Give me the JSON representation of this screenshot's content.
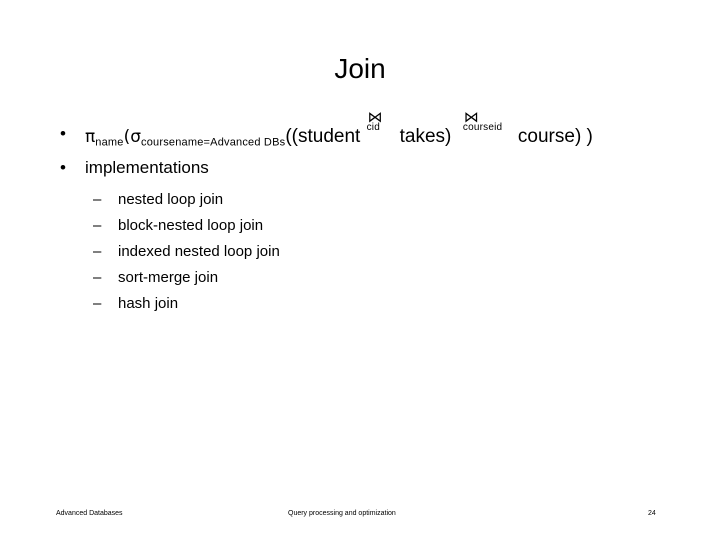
{
  "slide": {
    "title": "Join",
    "page_number": "24",
    "background_color": "#ffffff",
    "text_color": "#000000"
  },
  "body": {
    "bullets": [
      {
        "marker": "•",
        "kind": "formula",
        "formula": {
          "pi_symbol": "π",
          "pi_subscript": "name",
          "open_paren_1": "(",
          "sigma_symbol": "σ",
          "sigma_subscript": "coursename=Advanced DBs",
          "open_parens": "((",
          "relation_1": "student",
          "join_1_symbol": "⋈",
          "join_1_subscript": "cid",
          "relation_2": "takes",
          "close_paren_1": ")",
          "join_2_symbol": "⋈",
          "join_2_subscript": "courseid",
          "relation_3": "course",
          "close_parens": ") )",
          "plain_text": "πname(σcoursename=Advanced DBs((student ⋈cid takes) ⋈courseid course) )"
        }
      },
      {
        "marker": "•",
        "kind": "text",
        "label": "implementations"
      }
    ],
    "sub_bullets": [
      {
        "marker": "–",
        "label": "nested loop join"
      },
      {
        "marker": "–",
        "label": "block-nested loop join"
      },
      {
        "marker": "–",
        "label": "indexed nested loop join"
      },
      {
        "marker": "–",
        "label": "sort-merge join"
      },
      {
        "marker": "–",
        "label": "hash join"
      }
    ]
  },
  "footer": {
    "left": "Advanced Databases",
    "center": "Query processing and optimization",
    "right": "24"
  }
}
